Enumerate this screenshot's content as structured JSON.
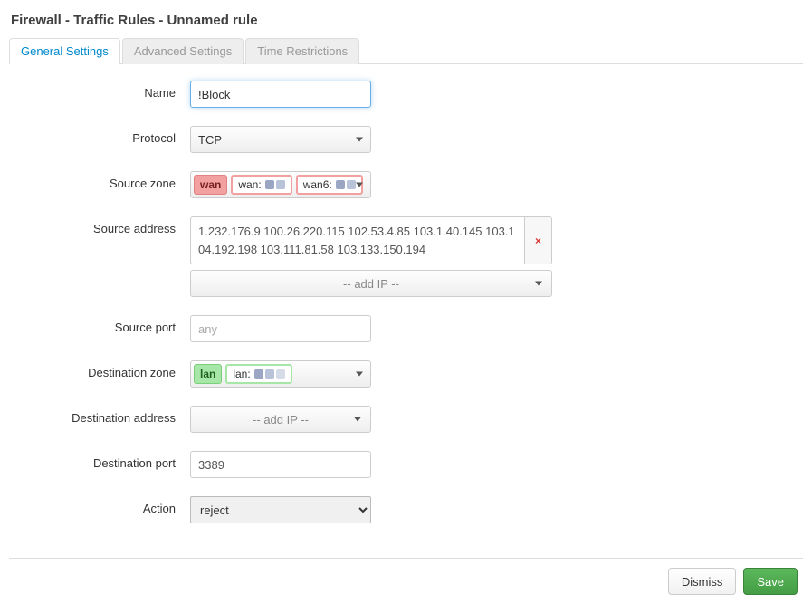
{
  "title": "Firewall - Traffic Rules - Unnamed rule",
  "tabs": {
    "general": "General Settings",
    "advanced": "Advanced Settings",
    "time": "Time Restrictions"
  },
  "labels": {
    "name": "Name",
    "protocol": "Protocol",
    "source_zone": "Source zone",
    "source_address": "Source address",
    "source_port": "Source port",
    "destination_zone": "Destination zone",
    "destination_address": "Destination address",
    "destination_port": "Destination port",
    "action": "Action"
  },
  "values": {
    "name": "!Block",
    "protocol": "TCP",
    "source_zone": {
      "zone": "wan",
      "ifaces": [
        "wan:",
        "wan6:"
      ]
    },
    "source_addresses": "1.232.176.9 100.26.220.115 102.53.4.85 103.1.40.145 103.104.192.198 103.111.81.58 103.133.150.194",
    "source_port_placeholder": "any",
    "destination_zone": {
      "zone": "lan",
      "ifaces": [
        "lan:"
      ]
    },
    "destination_port": "3389",
    "action": "reject",
    "add_ip_label": "-- add IP --"
  },
  "footer": {
    "dismiss": "Dismiss",
    "save": "Save"
  }
}
